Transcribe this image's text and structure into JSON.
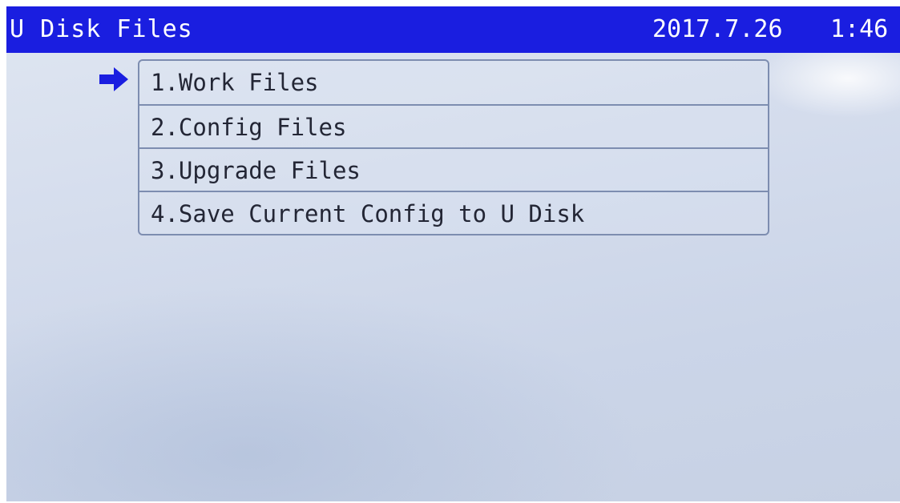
{
  "header": {
    "title": "U Disk Files",
    "date": "2017.7.26",
    "time": "1:46"
  },
  "menu": {
    "selected_index": 0,
    "items": [
      {
        "label": "1.Work Files"
      },
      {
        "label": "2.Config Files"
      },
      {
        "label": "3.Upgrade Files"
      },
      {
        "label": "4.Save Current Config to U Disk"
      }
    ]
  },
  "colors": {
    "title_bar": "#1a1ee0",
    "selector_arrow": "#1a1ee0",
    "menu_border": "#7d8db0",
    "text": "#232635"
  },
  "icons": {
    "selector": "right-arrow-icon"
  }
}
